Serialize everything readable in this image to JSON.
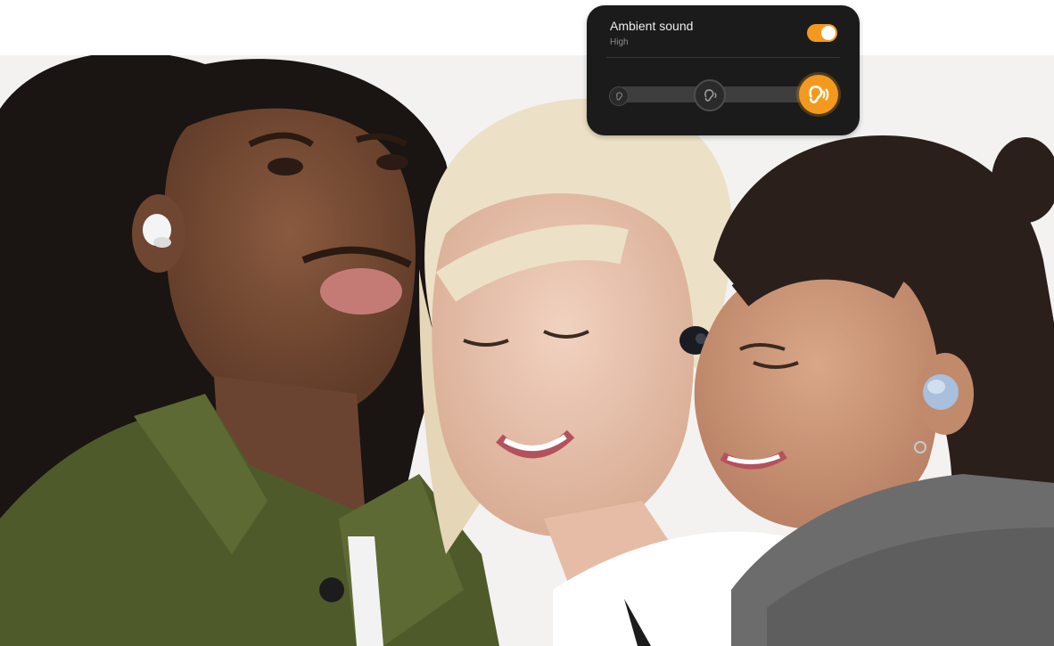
{
  "ambient_panel": {
    "title": "Ambient sound",
    "level_label": "High",
    "enabled": true,
    "levels": [
      "low",
      "medium",
      "high"
    ],
    "selected_level_index": 2,
    "accent_color": "#f39a1e",
    "icons": {
      "low": "ear-icon",
      "medium": "ear-sound-icon",
      "high": "ear-sound-loud-icon"
    }
  },
  "hero_image": {
    "subject": "people-wearing-earbuds-photo"
  }
}
